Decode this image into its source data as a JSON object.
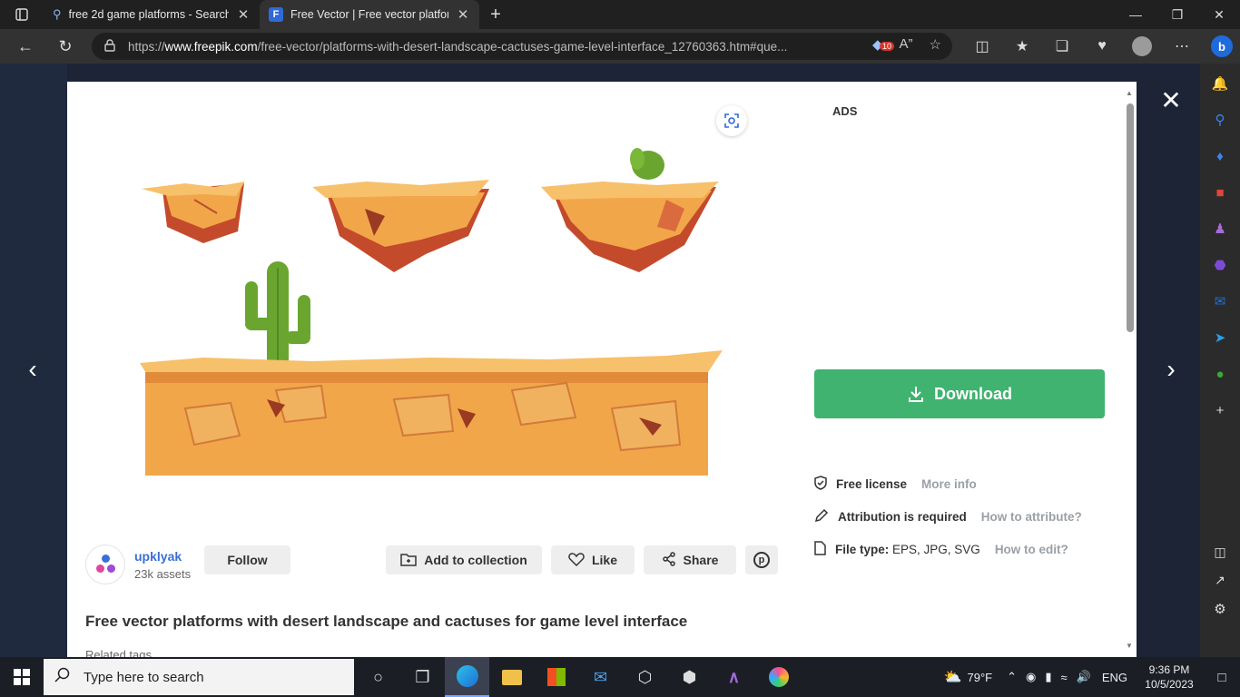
{
  "browser": {
    "tabs": [
      {
        "title": "free 2d game platforms - Search"
      },
      {
        "title": "Free Vector | Free vector platform"
      }
    ],
    "url_prefix": "https://",
    "url_host": "www.freepik.com",
    "url_path": "/free-vector/platforms-with-desert-landscape-cactuses-game-level-interface_12760363.htm#que...",
    "badge_count": "10"
  },
  "modal": {
    "ads_label": "ADS",
    "download_label": "Download",
    "license": {
      "label": "Free license",
      "link": "More info"
    },
    "attribution": {
      "label": "Attribution is required",
      "link": "How to attribute?"
    },
    "filetype": {
      "label": "File type:",
      "value": "EPS, JPG, SVG",
      "link": "How to edit?"
    },
    "author": {
      "name": "upklyak",
      "assets": "23k assets",
      "follow_label": "Follow"
    },
    "actions": {
      "add_collection": "Add to collection",
      "like": "Like",
      "share": "Share"
    },
    "title": "Free vector platforms with desert landscape and cactuses for game level interface",
    "related_label": "Related tags"
  },
  "taskbar": {
    "search_placeholder": "Type here to search",
    "weather": "79°F",
    "language": "ENG",
    "time": "9:36 PM",
    "date": "10/5/2023"
  },
  "colors": {
    "download": "#3fb36f",
    "author_link": "#3a6fd8",
    "sand": "#f2a64a",
    "rock": "#c44a2c",
    "cactus": "#6aa62f"
  }
}
